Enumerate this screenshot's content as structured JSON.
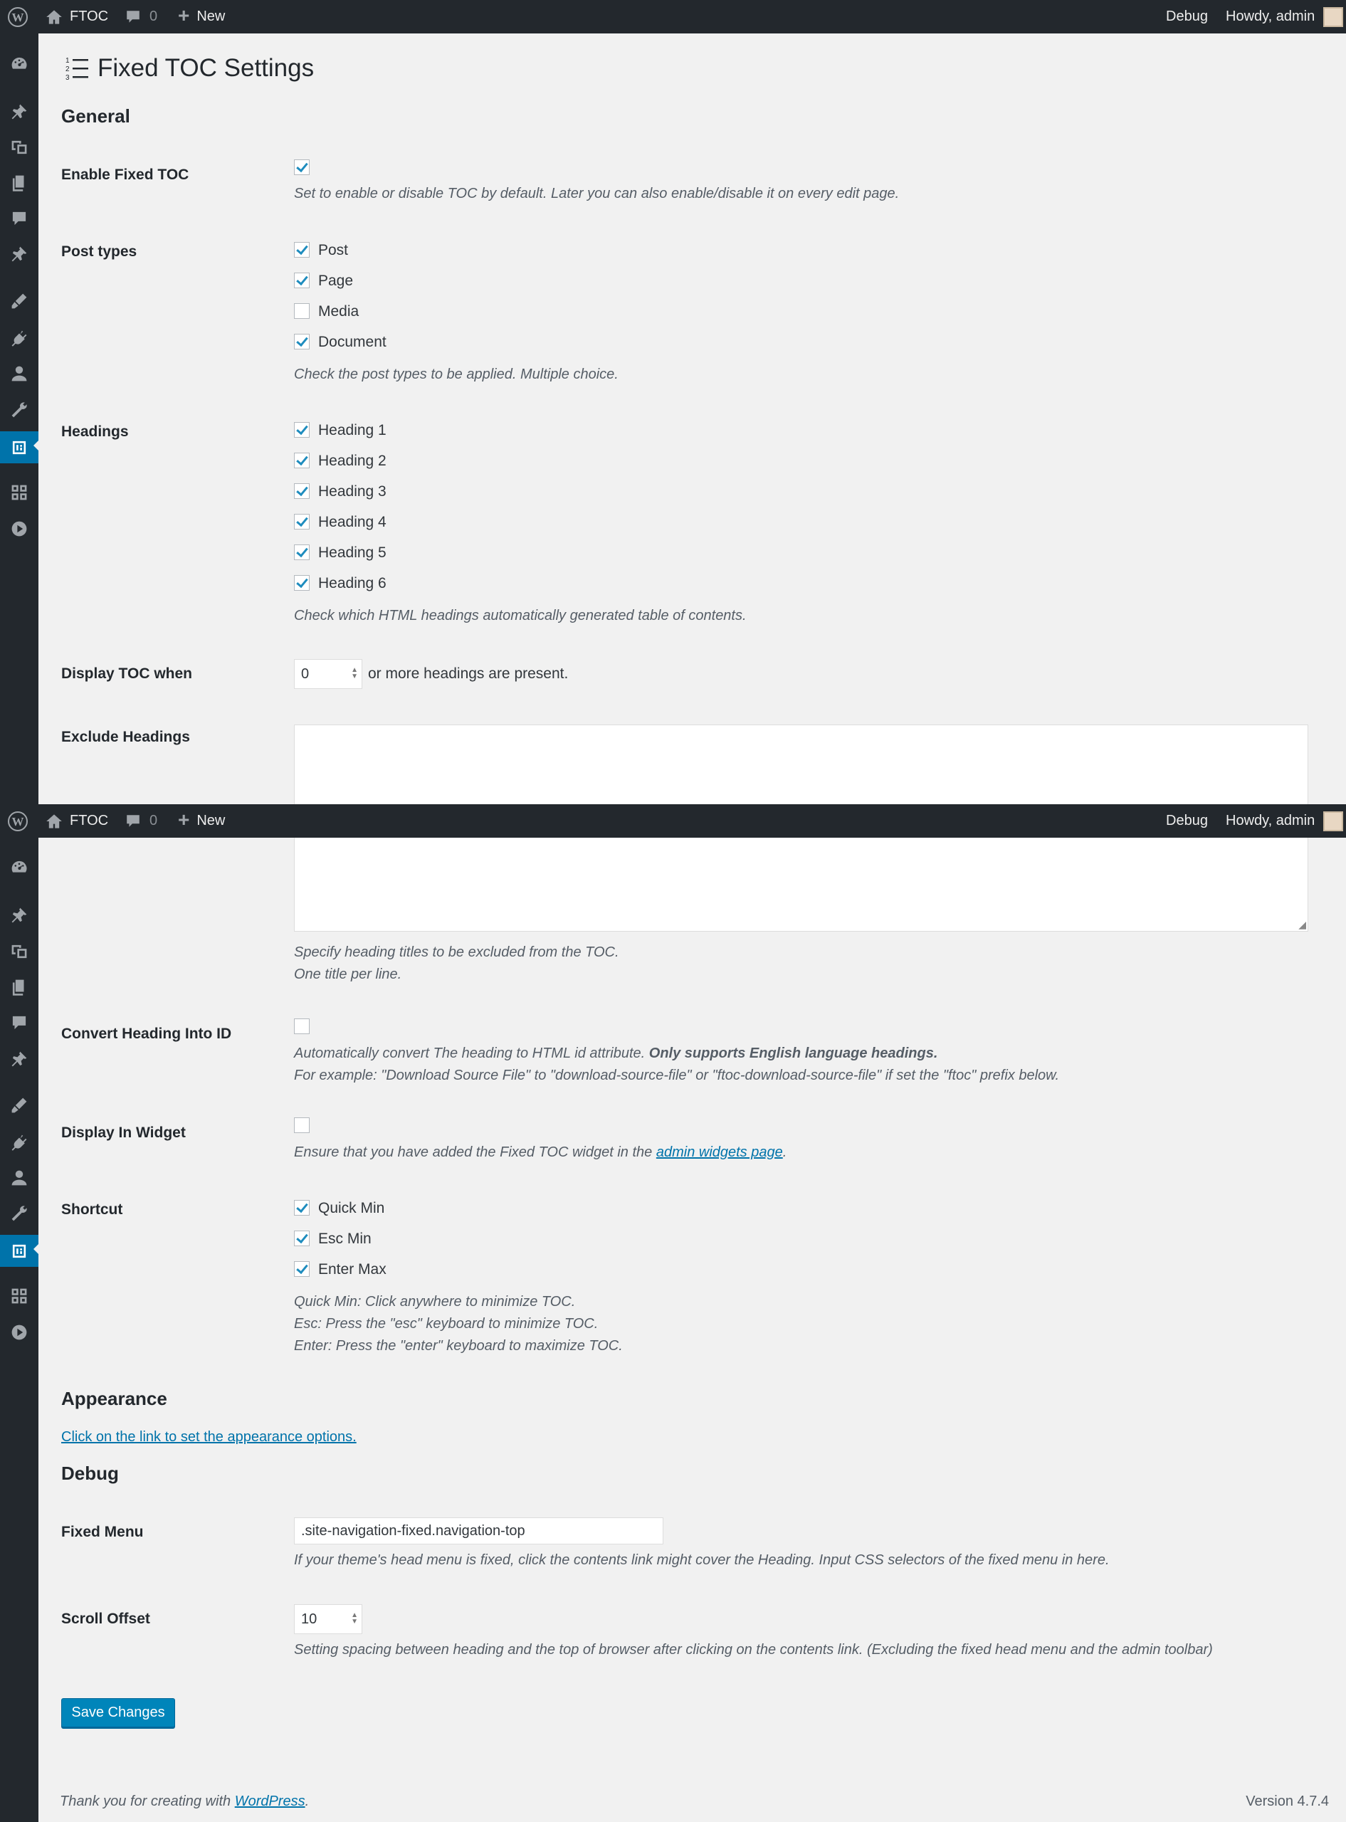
{
  "adminbar": {
    "site_name": "FTOC",
    "comments_count": "0",
    "new_label": "New",
    "debug_label": "Debug",
    "howdy": "Howdy, admin"
  },
  "page": {
    "title": "Fixed TOC Settings",
    "sections": {
      "general": "General",
      "appearance": "Appearance",
      "debug": "Debug"
    }
  },
  "general": {
    "enable_fixed_toc": {
      "label": "Enable Fixed TOC",
      "checked": true,
      "desc": "Set to enable or disable TOC by default. Later you can also enable/disable it on every edit page."
    },
    "post_types": {
      "label": "Post types",
      "options": [
        {
          "label": "Post",
          "checked": true
        },
        {
          "label": "Page",
          "checked": true
        },
        {
          "label": "Media",
          "checked": false
        },
        {
          "label": "Document",
          "checked": true
        }
      ],
      "desc": "Check the post types to be applied. Multiple choice."
    },
    "headings": {
      "label": "Headings",
      "options": [
        {
          "label": "Heading 1",
          "checked": true
        },
        {
          "label": "Heading 2",
          "checked": true
        },
        {
          "label": "Heading 3",
          "checked": true
        },
        {
          "label": "Heading 4",
          "checked": true
        },
        {
          "label": "Heading 5",
          "checked": true
        },
        {
          "label": "Heading 6",
          "checked": true
        }
      ],
      "desc": "Check which HTML headings automatically generated table of contents."
    },
    "display_toc_when": {
      "label": "Display TOC when",
      "value": "0",
      "suffix": "or more headings are present."
    },
    "exclude_headings": {
      "label": "Exclude Headings",
      "value": "",
      "desc_line1": "Specify heading titles to be excluded from the TOC.",
      "desc_line2": "One title per line."
    },
    "convert_heading_id": {
      "label": "Convert Heading Into ID",
      "checked": false,
      "desc_line1_plain": "Automatically convert The heading to HTML id attribute.",
      "desc_line1_bold": "Only supports English language headings.",
      "desc_line2": "For example: \"Download Source File\" to \"download-source-file\" or \"ftoc-download-source-file\" if set the \"ftoc\" prefix below."
    },
    "display_in_widget": {
      "label": "Display In Widget",
      "checked": false,
      "desc_before": "Ensure that you have added the Fixed TOC widget in the",
      "desc_link": "admin widgets page",
      "desc_after": "."
    },
    "shortcut": {
      "label": "Shortcut",
      "options": [
        {
          "label": "Quick Min",
          "checked": true
        },
        {
          "label": "Esc Min",
          "checked": true
        },
        {
          "label": "Enter Max",
          "checked": true
        }
      ],
      "desc_lines": [
        "Quick Min: Click anywhere to minimize TOC.",
        "Esc: Press the \"esc\" keyboard to minimize TOC.",
        "Enter: Press the \"enter\" keyboard to maximize TOC."
      ]
    }
  },
  "appearance": {
    "link": "Click on the link to set the appearance options."
  },
  "debug": {
    "fixed_menu": {
      "label": "Fixed Menu",
      "value": ".site-navigation-fixed.navigation-top",
      "desc": "If your theme's head menu is fixed, click the contents link might cover the Heading. Input CSS selectors of the fixed menu in here."
    },
    "scroll_offset": {
      "label": "Scroll Offset",
      "value": "10",
      "desc": "Setting spacing between heading and the top of browser after clicking on the contents link. (Excluding the fixed head menu and the admin toolbar)"
    }
  },
  "save_button": "Save Changes",
  "footer": {
    "thanks_before": "Thank you for creating with",
    "thanks_link": "WordPress",
    "thanks_after": ".",
    "version": "Version 4.7.4"
  },
  "sidebar_icons": [
    "dashboard-icon",
    "posts-icon",
    "media-icon",
    "pages-icon",
    "comments-icon",
    "pin-icon",
    "appearance-icon",
    "plugins-icon",
    "users-icon",
    "tools-icon",
    "fixed-toc-icon",
    "grid-icon",
    "play-icon"
  ],
  "colors": {
    "adminbar_bg": "#23282d",
    "accent": "#0073aa",
    "button": "#0085ba",
    "background": "#f1f1f1"
  }
}
